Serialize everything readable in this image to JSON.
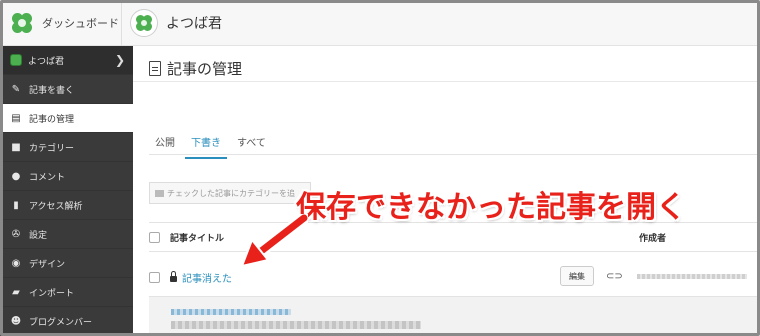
{
  "header": {
    "dashboard_label": "ダッシュボード",
    "blog_name": "よつば君"
  },
  "sidebar": {
    "items": [
      {
        "label": "よつば君",
        "icon": "clover-icon"
      },
      {
        "label": "記事を書く",
        "icon": "edit-icon"
      },
      {
        "label": "記事の管理",
        "icon": "document-icon"
      },
      {
        "label": "カテゴリー",
        "icon": "folder-icon"
      },
      {
        "label": "コメント",
        "icon": "comment-icon"
      },
      {
        "label": "アクセス解析",
        "icon": "bar-chart-icon"
      },
      {
        "label": "設定",
        "icon": "wrench-icon"
      },
      {
        "label": "デザイン",
        "icon": "palette-icon"
      },
      {
        "label": "インポート",
        "icon": "truck-icon"
      },
      {
        "label": "ブログメンバー",
        "icon": "users-icon"
      }
    ]
  },
  "main": {
    "title": "記事の管理",
    "tabs": [
      {
        "label": "公開"
      },
      {
        "label": "下書き"
      },
      {
        "label": "すべて"
      }
    ],
    "category_placeholder": "チェックした記事にカテゴリーを追",
    "table": {
      "col_title": "記事タイトル",
      "col_author": "作成者",
      "rows": [
        {
          "title": "記事消えた",
          "edit_label": "編集"
        }
      ]
    }
  },
  "annotation": {
    "text": "保存できなかった記事を開く",
    "color": "#e8211a"
  },
  "colors": {
    "accent": "#2a8fbd",
    "sidebar_bg": "#3a3a3a"
  }
}
